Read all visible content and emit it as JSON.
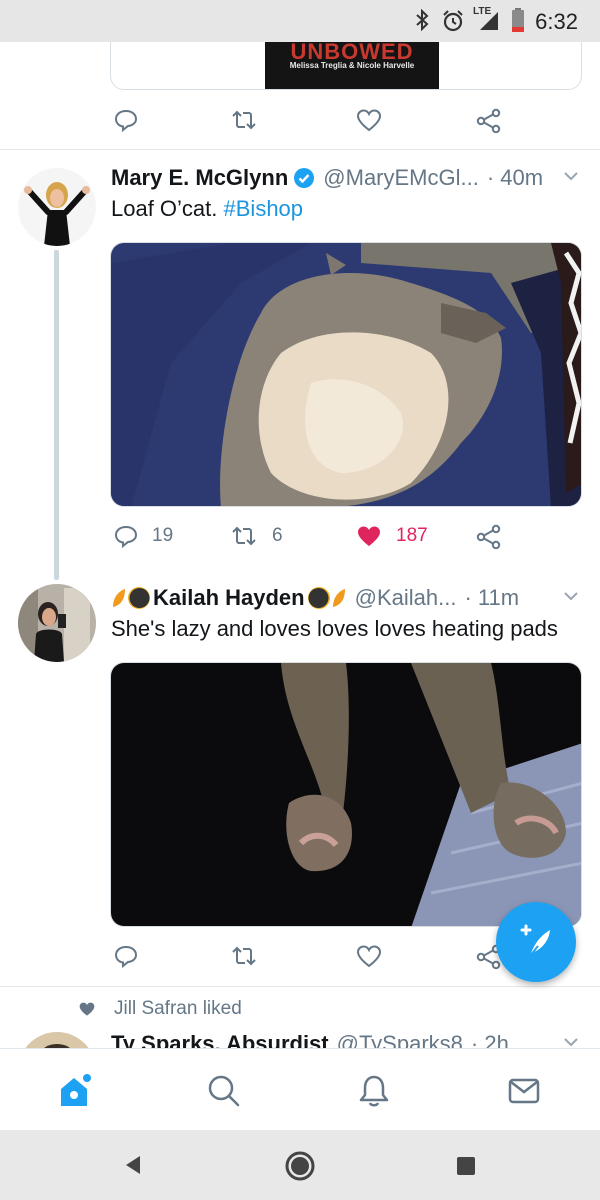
{
  "status_bar": {
    "time": "6:32",
    "network": "LTE"
  },
  "previous_tweet": {
    "card_title": "UNBOWED",
    "card_subtitle": "Melissa Treglia & Nicole Harvelle"
  },
  "tweets": [
    {
      "name": "Mary E. McGlynn",
      "handle": "@MaryEMcGl...",
      "time": "· 40m",
      "text": "Loaf O’cat. ",
      "hashtag": "#Bishop",
      "replies": "19",
      "retweets": "6",
      "likes": "187"
    },
    {
      "name": "Kailah Hayden",
      "handle": "@Kailah...",
      "time": "· 11m",
      "text": "She's lazy and loves loves loves heating pads"
    }
  ],
  "liked_notice": "Jill Safran liked",
  "next_tweet": {
    "name": "Ty Sparks, Absurdist",
    "handle": "@TySparks8",
    "time": "· 2h"
  },
  "colors": {
    "accent": "#1da1f2",
    "like": "#e0245e",
    "muted": "#657786"
  }
}
